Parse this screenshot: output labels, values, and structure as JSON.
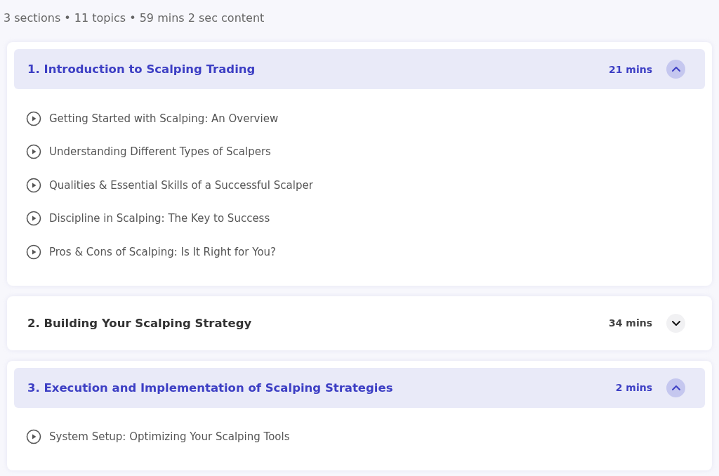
{
  "summary": "3 sections • 11 topics • 59 mins 2 sec content",
  "sections": [
    {
      "title": "1. Introduction to Scalping Trading",
      "duration": "21 mins",
      "expanded": true,
      "topics": [
        "Getting Started with Scalping: An Overview",
        "Understanding Different Types of Scalpers",
        "Qualities & Essential Skills of a Successful Scalper",
        "Discipline in Scalping: The Key to Success",
        "Pros & Cons of Scalping: Is It Right for You?"
      ]
    },
    {
      "title": "2. Building Your Scalping Strategy",
      "duration": "34 mins",
      "expanded": false
    },
    {
      "title": "3. Execution and Implementation of Scalping Strategies",
      "duration": "2 mins",
      "expanded": true,
      "topics": [
        "System Setup: Optimizing Your Scalping Tools"
      ]
    }
  ]
}
